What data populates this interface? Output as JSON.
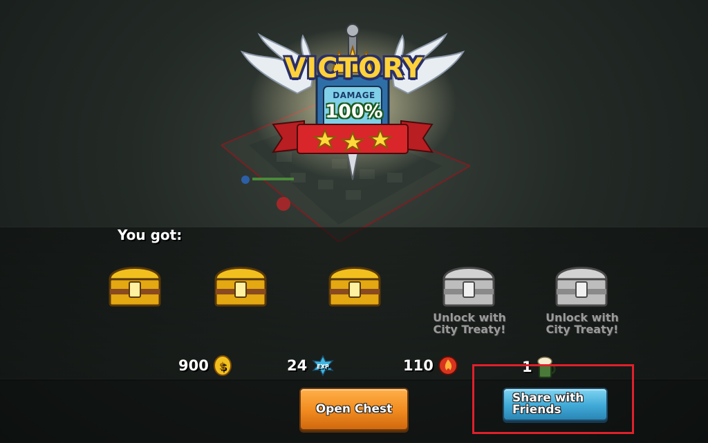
{
  "banner": {
    "title": "VICTORY",
    "damage_label": "DAMAGE",
    "damage_value": "100%",
    "stars": 3
  },
  "rewards_heading": "You got:",
  "chests": [
    {
      "state": "gold",
      "caption": ""
    },
    {
      "state": "gold",
      "caption": ""
    },
    {
      "state": "gold",
      "caption": ""
    },
    {
      "state": "locked",
      "caption_line1": "Unlock with",
      "caption_line2": "City Treaty!"
    },
    {
      "state": "locked",
      "caption_line1": "Unlock with",
      "caption_line2": "City Treaty!"
    }
  ],
  "resources": {
    "gold": {
      "value": "900",
      "icon": "gold-coin-icon"
    },
    "exp": {
      "value": "24",
      "icon": "exp-icon",
      "icon_label": "EXP"
    },
    "fire": {
      "value": "110",
      "icon": "fire-orb-icon"
    },
    "ale": {
      "value": "1",
      "icon": "ale-mug-icon"
    }
  },
  "buttons": {
    "open_chest": "Open Chest",
    "share_line1": "Share with",
    "share_line2": "Friends"
  },
  "colors": {
    "gold_chest": "#f2c01e",
    "locked_chest": "#c8c8c8",
    "open_button": "#f08a1e",
    "share_button": "#3fa9d6",
    "highlight": "#e0202a"
  }
}
